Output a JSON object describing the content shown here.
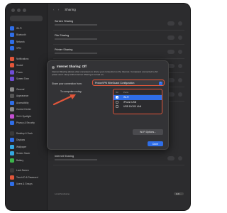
{
  "window": {
    "title": "Sharing"
  },
  "sidebar": {
    "items": [
      {
        "label": "Wi-Fi",
        "color": "#2f6ee8"
      },
      {
        "label": "Bluetooth",
        "color": "#2f6ee8"
      },
      {
        "label": "Network",
        "color": "#2f6ee8"
      },
      {
        "label": "VPN",
        "color": "#2f6ee8"
      },
      {
        "label": "Notifications",
        "color": "#e2563a"
      },
      {
        "label": "Sound",
        "color": "#e2563a"
      },
      {
        "label": "Focus",
        "color": "#6f4dd6"
      },
      {
        "label": "Screen Time",
        "color": "#6f4dd6"
      },
      {
        "label": "General",
        "color": "#8a8a8a"
      },
      {
        "label": "Appearance",
        "color": "#555"
      },
      {
        "label": "Accessibility",
        "color": "#2f6ee8"
      },
      {
        "label": "Control Center",
        "color": "#8a8a8a"
      },
      {
        "label": "Siri & Spotlight",
        "color": "#c34fd1"
      },
      {
        "label": "Privacy & Security",
        "color": "#2f6ee8"
      },
      {
        "label": "Desktop & Dock",
        "color": "#3a3a3a"
      },
      {
        "label": "Displays",
        "color": "#2f6ee8"
      },
      {
        "label": "Wallpaper",
        "color": "#35a8e0"
      },
      {
        "label": "Screen Saver",
        "color": "#35a8e0"
      },
      {
        "label": "Battery",
        "color": "#3cb44b"
      },
      {
        "label": "Lock Screen",
        "color": "#3a3a3a"
      },
      {
        "label": "Touch ID & Password",
        "color": "#e2563a"
      },
      {
        "label": "Users & Groups",
        "color": "#2f6ee8"
      }
    ]
  },
  "panel": {
    "rows": [
      {
        "title": "Screen Sharing"
      },
      {
        "title": "File Sharing"
      },
      {
        "title": "Printer Sharing"
      },
      {
        "title": "Remote Login"
      },
      {
        "title": "Remote Management"
      },
      {
        "title": "Remote Apple Events"
      },
      {
        "title": "Internet Sharing"
      }
    ],
    "local_hostname_label": "Local hostname",
    "edit_label": "Edit..."
  },
  "dialog": {
    "title": "Internet Sharing: Off",
    "description": "Internet Sharing allows other computers to share your connection to the Internet. Computers connected to AC power won't sleep while Internet Sharing is turned on.",
    "share_label": "Share your connection from:",
    "share_value": "ProtonVPN WireGuard Configuration",
    "computers_label": "To computers using:",
    "table_headers": [
      "On",
      "Ports"
    ],
    "ports": [
      {
        "name": "Wi-Fi",
        "selected": true
      },
      {
        "name": "iPhone USB",
        "selected": false
      },
      {
        "name": "USB 10/100 LAN",
        "selected": false
      }
    ],
    "wifi_options_label": "Wi-Fi Options...",
    "done_label": "Done"
  },
  "colors": {
    "accent": "#2f6ee8",
    "highlight": "#e2563a"
  }
}
